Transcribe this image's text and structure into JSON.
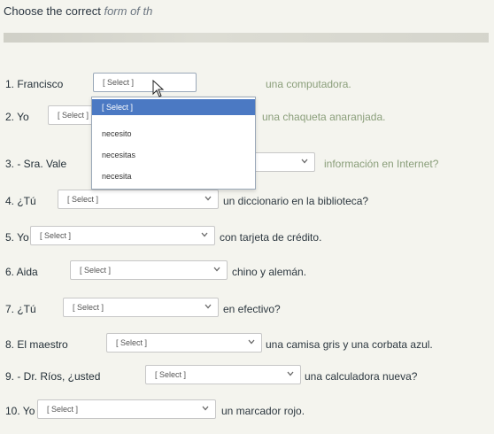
{
  "header": {
    "title_prefix": "Choose the correct",
    "title_italic": "form of th"
  },
  "select_placeholder": "[ Select ]",
  "questions": [
    {
      "label": "1. Francisco",
      "after": "una computadora."
    },
    {
      "label": "2. Yo",
      "after": "una chaqueta anaranjada."
    },
    {
      "label": "3. - Sra. Vale",
      "after": "información en Internet?"
    },
    {
      "label": "4. ¿Tú",
      "after": "un diccionario en la biblioteca?"
    },
    {
      "label": "5. Yo",
      "after": "con tarjeta de crédito."
    },
    {
      "label": "6. Aida",
      "after": "chino y alemán."
    },
    {
      "label": "7. ¿Tú",
      "after": "en efectivo?"
    },
    {
      "label": "8. El maestro",
      "after": "una camisa gris y una corbata azul."
    },
    {
      "label": "9. - Dr. Ríos, ¿usted",
      "after": "una calculadora nueva?"
    },
    {
      "label": "10. Yo",
      "after": "un marcador rojo."
    }
  ],
  "dropdown": {
    "options": [
      "[ Select ]",
      "necesito",
      "necesitas",
      "necesita"
    ],
    "highlighted_index": 0
  },
  "colors": {
    "highlight": "#4b79c3",
    "background": "#f4f4ee"
  }
}
